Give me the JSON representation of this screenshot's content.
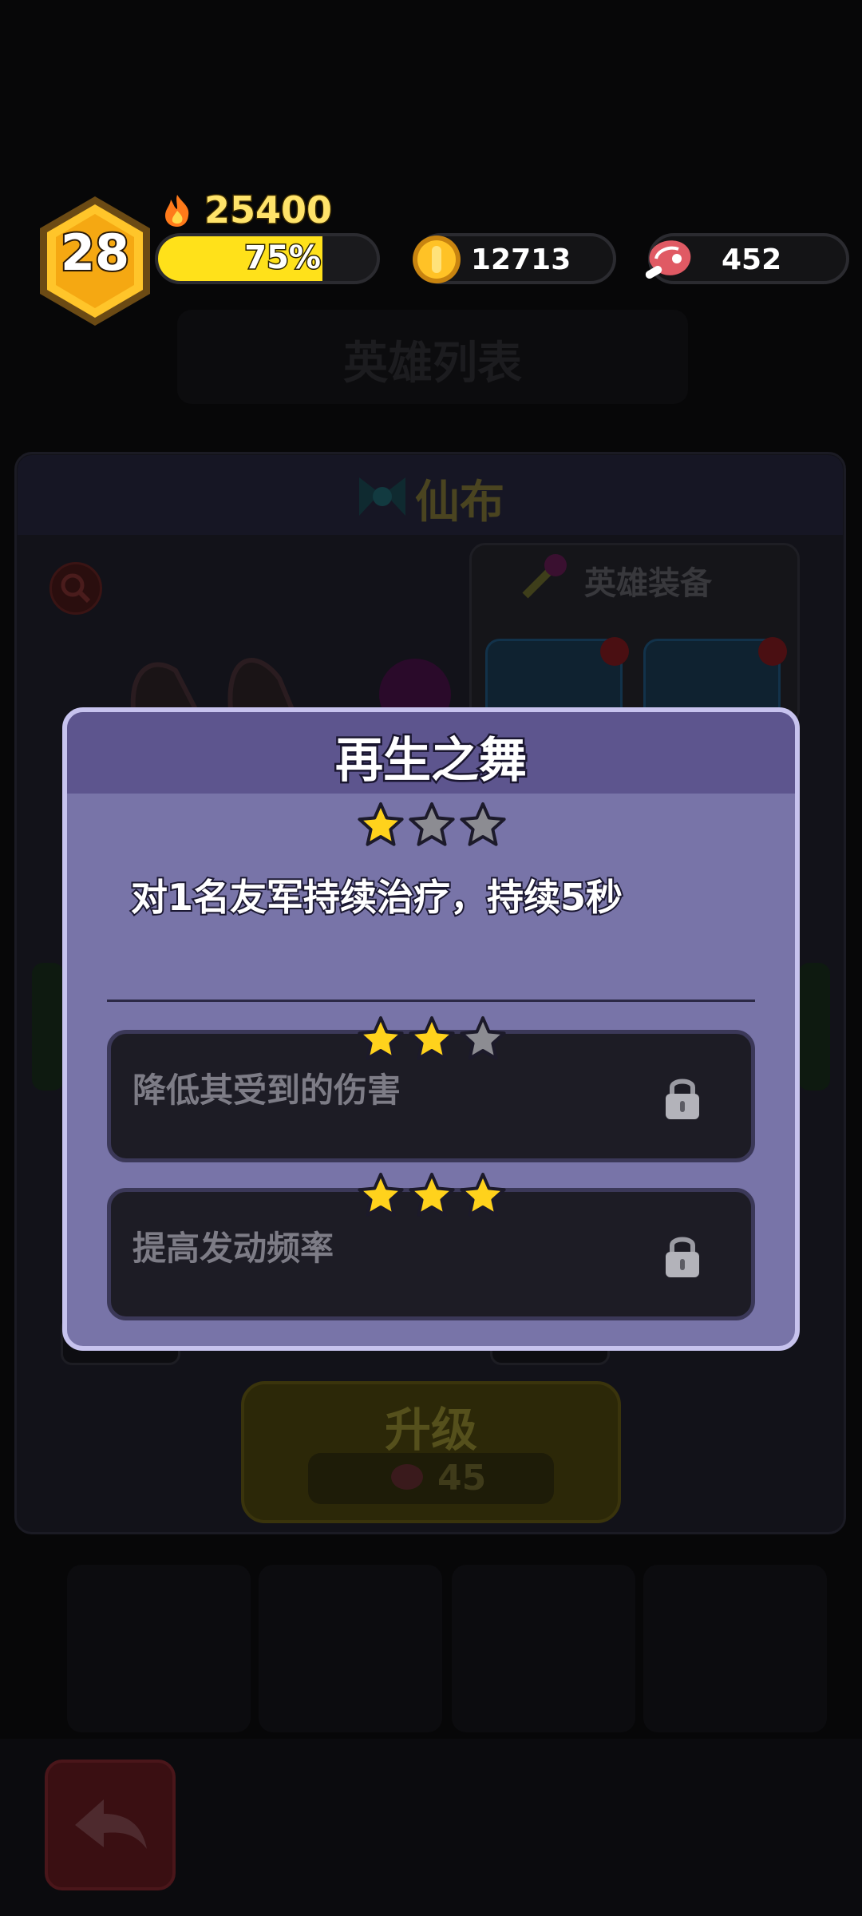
{
  "hud": {
    "level": "28",
    "power": "25400",
    "xp_percent_label": "75%",
    "xp_fraction": 0.75,
    "gold": "12713",
    "meat": "452"
  },
  "background": {
    "page_title": "英雄列表",
    "hero_name": "仙布",
    "equipment_title": "英雄装备",
    "upgrade_label": "升级",
    "upgrade_cost": "45"
  },
  "modal": {
    "title": "再生之舞",
    "current_stars": 1,
    "description": "对1名友军持续治疗，持续5秒",
    "tiers": [
      {
        "stars": 2,
        "text": "降低其受到的伤害",
        "locked": true
      },
      {
        "stars": 3,
        "text": "提高发动频率",
        "locked": true
      }
    ]
  },
  "colors": {
    "star_gold": "#ffd21c",
    "star_gray": "#8c8c92",
    "modal_bg": "#7874a8",
    "modal_header": "#5d558e",
    "xp_fill": "#ffe11a"
  },
  "icons": {
    "power": "flame-icon",
    "gold": "gold-coin-icon",
    "meat": "meat-icon",
    "lock": "lock-icon",
    "back": "back-arrow-icon",
    "search": "search-icon"
  }
}
